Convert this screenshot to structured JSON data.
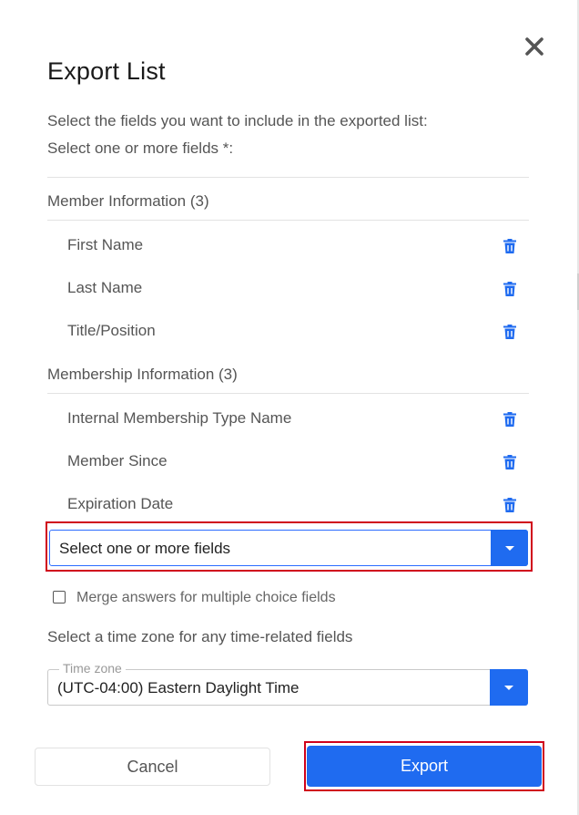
{
  "dialog": {
    "title": "Export List",
    "intro_line1": "Select the fields you want to include in the exported list:",
    "intro_line2": "Select one or more fields *:"
  },
  "sections": [
    {
      "header": "Member Information (3)",
      "fields": [
        {
          "label": "First Name"
        },
        {
          "label": "Last Name"
        },
        {
          "label": "Title/Position"
        }
      ]
    },
    {
      "header": "Membership Information (3)",
      "fields": [
        {
          "label": "Internal Membership Type Name"
        },
        {
          "label": "Member Since"
        },
        {
          "label": "Expiration Date"
        }
      ]
    }
  ],
  "field_select": {
    "placeholder": "Select one or more fields"
  },
  "merge_option": {
    "label": "Merge answers for multiple choice fields",
    "checked": false
  },
  "timezone": {
    "prompt": "Select a time zone for any time-related fields",
    "legend": "Time zone",
    "value": "(UTC-04:00) Eastern Daylight Time"
  },
  "buttons": {
    "cancel": "Cancel",
    "export": "Export"
  },
  "colors": {
    "accent": "#1f6bf0",
    "highlight_outline": "#d0021b"
  }
}
